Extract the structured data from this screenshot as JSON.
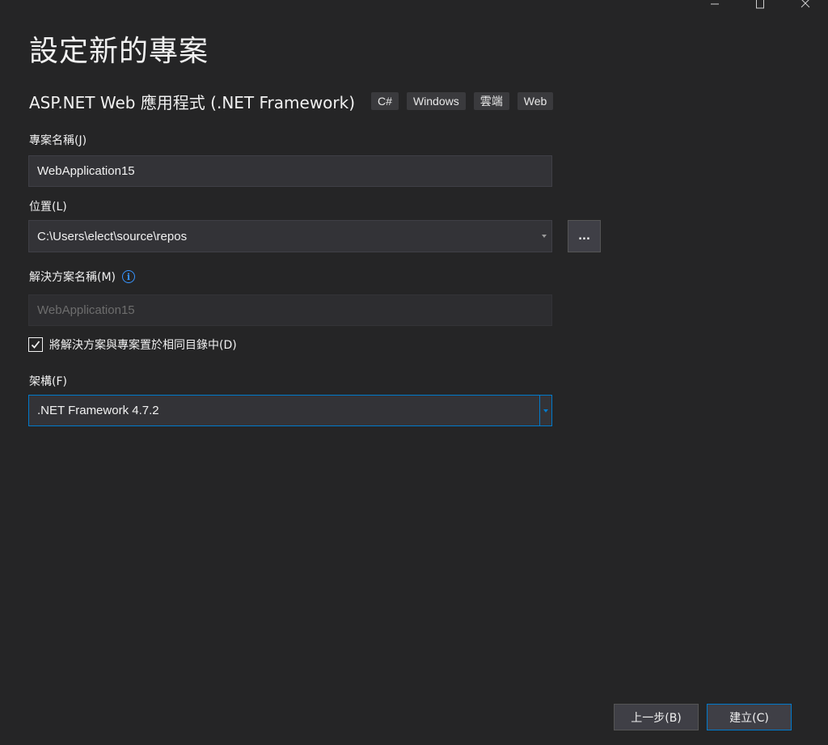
{
  "window": {
    "minimize_icon": "minimize-icon",
    "maximize_icon": "maximize-icon",
    "close_icon": "close-icon"
  },
  "page_title": "設定新的專案",
  "template": {
    "name": "ASP.NET Web 應用程式 (.NET Framework)",
    "tags": [
      "C#",
      "Windows",
      "雲端",
      "Web"
    ]
  },
  "form": {
    "project_name_label": "專案名稱(J)",
    "project_name_value": "WebApplication15",
    "location_label": "位置(L)",
    "location_value": "C:\\Users\\elect\\source\\repos",
    "browse_label": "...",
    "solution_name_label": "解決方案名稱(M)",
    "solution_name_info_icon": "info-icon",
    "solution_name_value": "WebApplication15",
    "same_dir_checked": true,
    "same_dir_label": "將解決方案與專案置於相同目錄中(D)",
    "framework_label": "架構(F)",
    "framework_value": ".NET Framework 4.7.2"
  },
  "buttons": {
    "back": "上一步(B)",
    "create": "建立(C)"
  },
  "colors": {
    "background": "#252526",
    "accent": "#007acc",
    "input_bg": "#333337"
  }
}
